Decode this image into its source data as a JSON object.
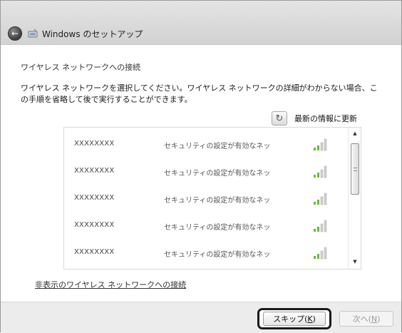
{
  "window": {
    "title": "Windows のセットアップ",
    "icon": "wireless-setup-icon",
    "back_icon": "back-arrow-icon"
  },
  "main": {
    "heading": "ワイヤレス ネットワークへの接続",
    "description": "ワイヤレス ネットワークを選択してください。ワイヤレス ネットワークの詳細がわからない場合、この手順を省略して後で実行することができます。",
    "refresh_label": "最新の情報に更新",
    "refresh_icon": "refresh-icon"
  },
  "networks": [
    {
      "name": "XXXXXXXX",
      "security": "セキュリティの設定が有効なネットワーク",
      "signal_icon": "signal-strength-icon"
    },
    {
      "name": "XXXXXXXX",
      "security": "セキュリティの設定が有効なネットワーク",
      "signal_icon": "signal-strength-icon"
    },
    {
      "name": "XXXXXXXX",
      "security": "セキュリティの設定が有効なネットワーク",
      "signal_icon": "signal-strength-icon"
    },
    {
      "name": "XXXXXXXX",
      "security": "セキュリティの設定が有効なネットワーク",
      "signal_icon": "signal-strength-icon"
    },
    {
      "name": "XXXXXXXX",
      "security": "セキュリティの設定が有効なネットワーク",
      "signal_icon": "signal-strength-icon"
    }
  ],
  "hidden_network_link": "非表示のワイヤレス ネットワークへの接続",
  "buttons": {
    "skip_label": "スキップ",
    "skip_key": "K",
    "next_label": "次へ",
    "next_key": "N"
  }
}
